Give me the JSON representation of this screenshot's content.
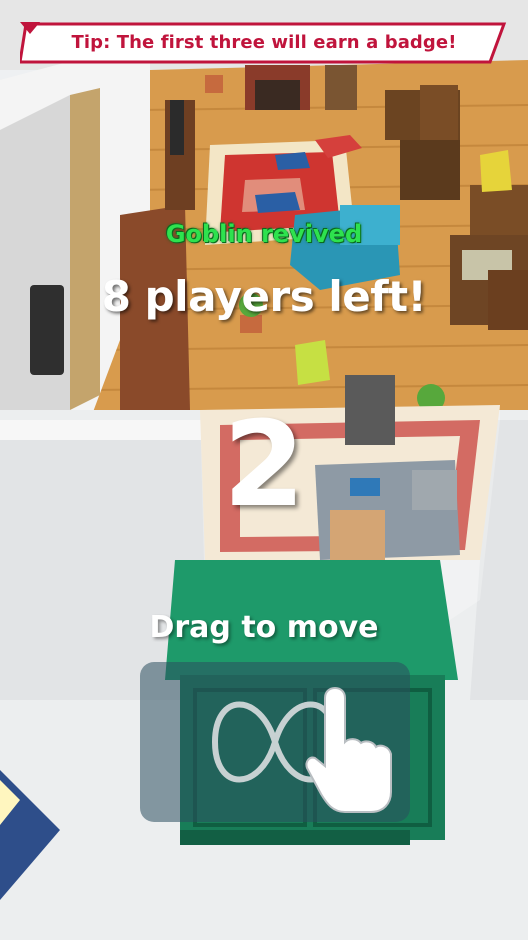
{
  "tip": {
    "text": "Tip: The first three will earn a badge!"
  },
  "status": {
    "revived": "Goblin revived",
    "players_left": "8 players left!"
  },
  "countdown": {
    "value": "2"
  },
  "instruction": {
    "text": "Drag to move"
  },
  "icons": {
    "gesture": "infinity-drag-icon",
    "hand": "hand-pointer-icon"
  },
  "colors": {
    "tip_text": "#c0143c",
    "revived": "#2ee24e",
    "cabinet": "#1e9a6a",
    "floor": "#d79a4c"
  }
}
